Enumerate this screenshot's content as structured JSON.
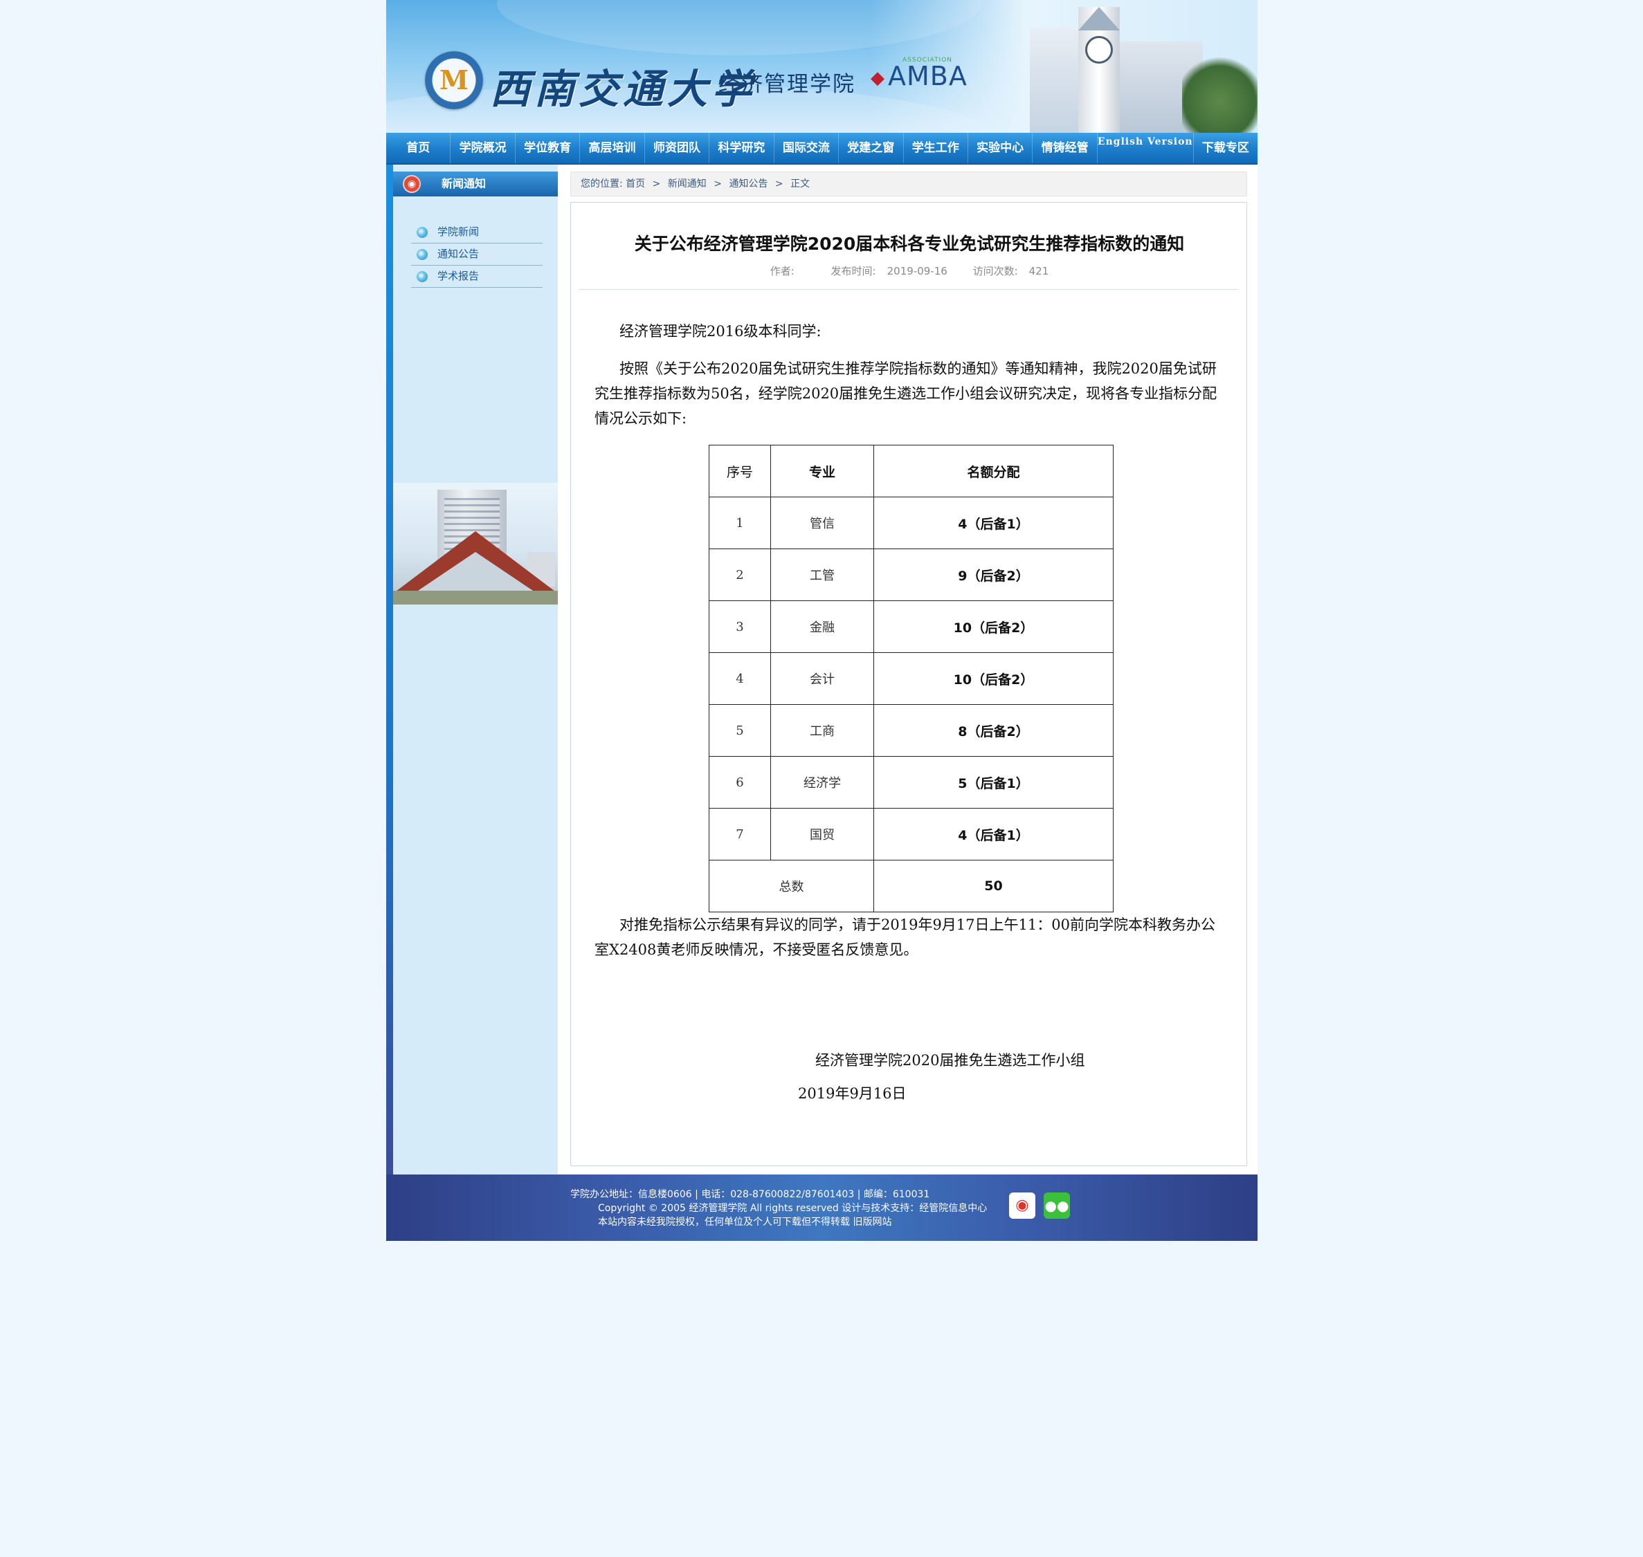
{
  "header": {
    "university": "西南交通大学",
    "school": "经济管理学院",
    "amba": "AMBA",
    "amba_assoc": "ASSOCIATION"
  },
  "nav": [
    {
      "label": "首页"
    },
    {
      "label": "学院概况"
    },
    {
      "label": "学位教育"
    },
    {
      "label": "高层培训"
    },
    {
      "label": "师资团队"
    },
    {
      "label": "科学研究"
    },
    {
      "label": "国际交流"
    },
    {
      "label": "党建之窗"
    },
    {
      "label": "学生工作"
    },
    {
      "label": "实验中心"
    },
    {
      "label": "情铸经管"
    },
    {
      "label": "English Version"
    },
    {
      "label": "下载专区"
    }
  ],
  "sidebar": {
    "title": "新闻通知",
    "items": [
      {
        "label": "学院新闻"
      },
      {
        "label": "通知公告"
      },
      {
        "label": "学术报告"
      }
    ]
  },
  "breadcrumb": {
    "prefix": "您的位置:",
    "items": [
      "首页",
      "新闻通知",
      "通知公告",
      "正文"
    ],
    "separator": ">"
  },
  "article": {
    "title": "关于公布经济管理学院2020届本科各专业免试研究生推荐指标数的通知",
    "author_label": "作者:",
    "author": "",
    "date_label": "发布时间:",
    "date": "2019-09-16",
    "views_label": "访问次数:",
    "views": "421",
    "greeting": "经济管理学院2016级本科同学:",
    "para1": "按照《关于公布2020届免试研究生推荐学院指标数的通知》等通知精神，我院2020届免试研究生推荐指标数为50名，经学院2020届推免生遴选工作小组会议研究决定，现将各专业指标分配情况公示如下:",
    "table": {
      "headers": {
        "no": "序号",
        "major": "专业",
        "quota": "名额分配"
      },
      "rows": [
        {
          "no": "1",
          "major": "管信",
          "quota": "4（后备1）"
        },
        {
          "no": "2",
          "major": "工管",
          "quota": "9（后备2）"
        },
        {
          "no": "3",
          "major": "金融",
          "quota": "10（后备2）"
        },
        {
          "no": "4",
          "major": "会计",
          "quota": "10（后备2）"
        },
        {
          "no": "5",
          "major": "工商",
          "quota": "8（后备2）"
        },
        {
          "no": "6",
          "major": "经济学",
          "quota": "5（后备1）"
        },
        {
          "no": "7",
          "major": "国贸",
          "quota": "4（后备1）"
        }
      ],
      "total_label": "总数",
      "total": "50"
    },
    "para2": "对推免指标公示结果有异议的同学，请于2019年9月17日上午11：00前向学院本科教务办公室X2408黄老师反映情况，不接受匿名反馈意见。",
    "signature": "经济管理学院2020届推免生遴选工作小组",
    "sign_date": "2019年9月16日"
  },
  "footer": {
    "line1": "学院办公地址：信息楼0606 | 电话：028-87600822/87601403 | 邮编：610031",
    "line2": "Copyright © 2005 经济管理学院 All rights reserved 设计与技术支持：经管院信息中心",
    "line3_text": "本站内容未经我院授权，任何单位及个人可下载但不得转载",
    "line3_link": "旧版网站",
    "icons": [
      "weibo-icon",
      "wechat-icon"
    ]
  }
}
